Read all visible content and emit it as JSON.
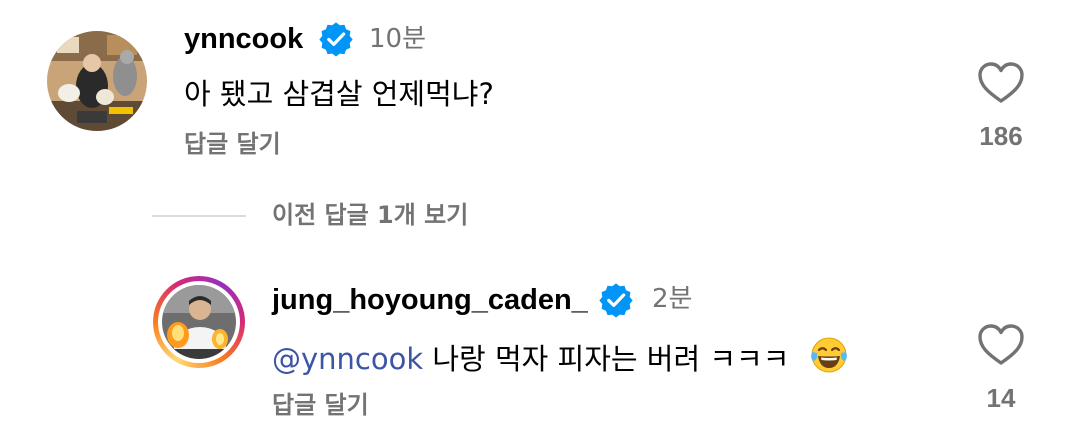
{
  "comments": [
    {
      "username": "ynncook",
      "verified": true,
      "time": "10분",
      "text": "아 됐고 삼겹살 언제먹냐?",
      "reply_label": "답글 달기",
      "likes": "186"
    }
  ],
  "view_previous_label": "이전 답글 1개 보기",
  "replies": [
    {
      "username": "jung_hoyoung_caden_",
      "verified": true,
      "time": "2분",
      "mention": "@ynncook",
      "text": " 나랑 먹자 피자는 버려 ㅋㅋㅋ",
      "emoji": "face-with-tears-of-joy",
      "reply_label": "답글 달기",
      "likes": "14"
    }
  ],
  "colors": {
    "verified_blue": "#0095f6",
    "secondary_text": "#737373",
    "mention": "#3c55a5",
    "story_ring": [
      "#feda75",
      "#fa7e1e",
      "#d62976",
      "#962fbf"
    ]
  }
}
